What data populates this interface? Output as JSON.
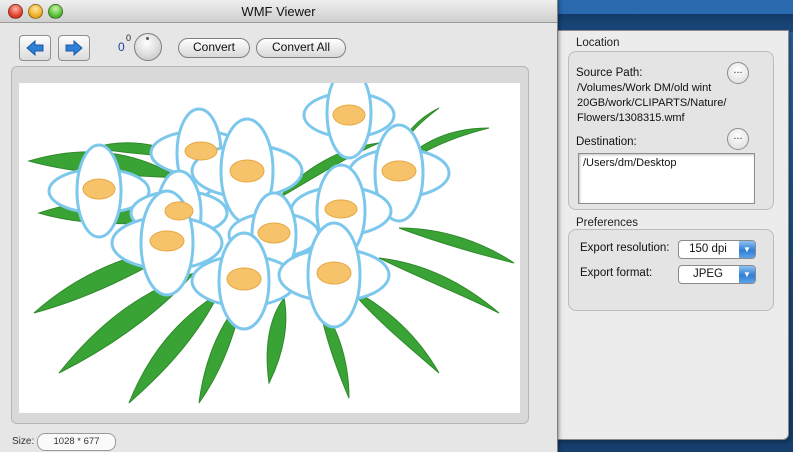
{
  "window": {
    "title": "WMF Viewer"
  },
  "toolbar": {
    "rotation_value": "0",
    "rotation_superscript": "0",
    "convert_label": "Convert",
    "convert_all_label": "Convert All"
  },
  "status": {
    "size_label": "Size:",
    "size_value": "1028 * 677"
  },
  "drawer": {
    "location": {
      "title": "Location",
      "source_label": "Source Path:",
      "source_path": "/Volumes/Work DM/old wint\n20GB/work/CLIPARTS/Nature/\nFlowers/1308315.wmf",
      "destination_label": "Destination:",
      "destination_path": "/Users/dm/Desktop",
      "browse_label": "..."
    },
    "preferences": {
      "title": "Preferences",
      "resolution_label": "Export resolution:",
      "resolution_value": "150 dpi",
      "format_label": "Export format:",
      "format_value": "JPEG"
    }
  },
  "colors": {
    "accent_blue": "#2f7fd6",
    "petal_outline": "#7cc7ec",
    "flower_center": "#f6c36a",
    "leaf_green": "#3aa335"
  }
}
